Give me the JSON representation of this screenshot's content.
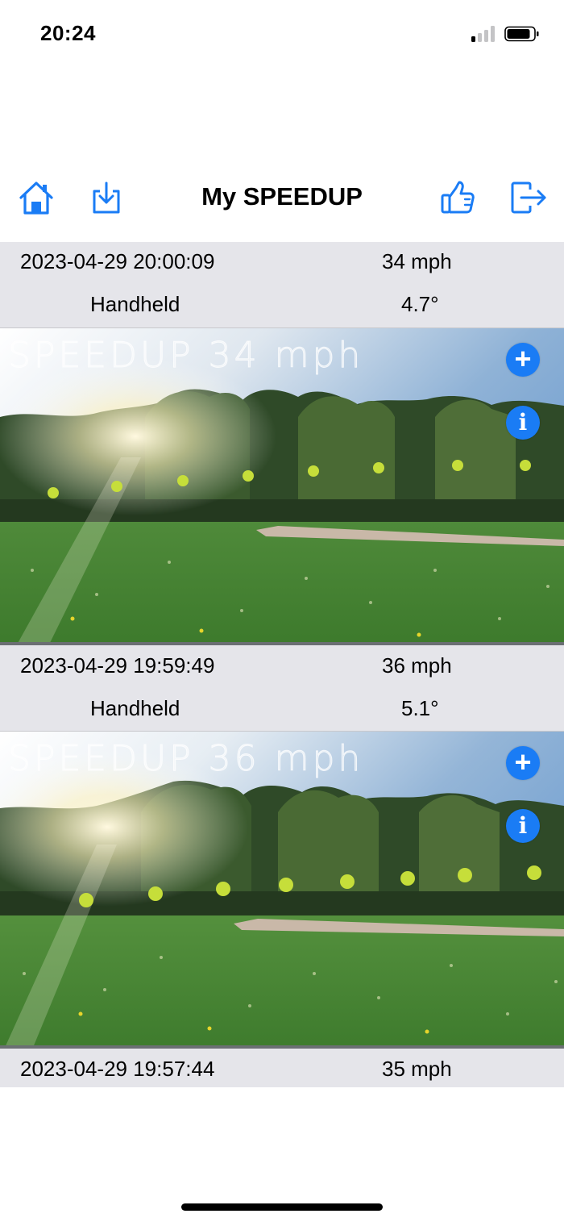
{
  "status_bar": {
    "time": "20:24"
  },
  "nav": {
    "title": "My SPEEDUP",
    "icons": {
      "home": "home-icon",
      "download": "download-icon",
      "like": "thumbs-up-icon",
      "logout": "logout-icon"
    }
  },
  "colors": {
    "accent": "#1a7cf5",
    "row_background": "#e5e5ea"
  },
  "entries": [
    {
      "datetime": "2023-04-29 20:00:09",
      "speed": "34 mph",
      "mode": "Handheld",
      "angle": "4.7°",
      "overlay": "SPEEDUP 34 mph"
    },
    {
      "datetime": "2023-04-29 19:59:49",
      "speed": "36 mph",
      "mode": "Handheld",
      "angle": "5.1°",
      "overlay": "SPEEDUP 36 mph"
    },
    {
      "datetime": "2023-04-29 19:57:44",
      "speed": "35 mph"
    }
  ],
  "photo_buttons": {
    "add_glyph": "+",
    "info_glyph": "i"
  }
}
